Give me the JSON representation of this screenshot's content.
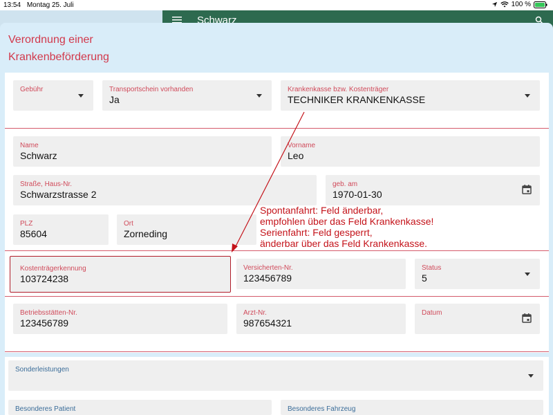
{
  "status_bar": {
    "time": "13:54",
    "date": "Montag 25. Juli",
    "battery": "100 %"
  },
  "background_app": {
    "title": "Schwarz"
  },
  "modal": {
    "title": "Verordnung einer\nKrankenbeförderung"
  },
  "fields": {
    "gebuehr": {
      "label": "Gebühr",
      "value": ""
    },
    "transportschein": {
      "label": "Transportschein vorhanden",
      "value": "Ja"
    },
    "krankenkasse": {
      "label": "Krankenkasse bzw. Kostenträger",
      "value": "TECHNIKER KRANKENKASSE"
    },
    "name": {
      "label": "Name",
      "value": "Schwarz"
    },
    "vorname": {
      "label": "Vorname",
      "value": "Leo"
    },
    "strasse": {
      "label": "Straße, Haus-Nr.",
      "value": "Schwarzstrasse 2"
    },
    "geb_am": {
      "label": "geb. am",
      "value": "1970-01-30"
    },
    "plz": {
      "label": "PLZ",
      "value": "85604"
    },
    "ort": {
      "label": "Ort",
      "value": "Zorneding"
    },
    "kostentraegerkennung": {
      "label": "Kostenträgerkennung",
      "value": "103724238"
    },
    "versicherten_nr": {
      "label": "Versicherten-Nr.",
      "value": "123456789"
    },
    "status": {
      "label": "Status",
      "value": "5"
    },
    "betriebsstaetten_nr": {
      "label": "Betriebsstätten-Nr.",
      "value": "123456789"
    },
    "arzt_nr": {
      "label": "Arzt-Nr.",
      "value": "987654321"
    },
    "datum": {
      "label": "Datum",
      "value": ""
    },
    "sonderleistungen": {
      "label": "Sonderleistungen",
      "value": ""
    },
    "besonderes_patient": {
      "label": "Besonderes Patient",
      "value": ""
    },
    "besonderes_fahrzeug": {
      "label": "Besonderes Fahrzeug",
      "value": ""
    }
  },
  "annotation": {
    "text": "Spontanfahrt: Feld änderbar,\nempfohlen über das Feld Krankenkasse!\nSerienfahrt: Feld gesperrt,\nänderbar über das Feld Krankenkasse."
  },
  "colors": {
    "accent": "#d2384b",
    "annotation": "#c4131a",
    "modal_bg": "#d9edf9",
    "field_bg": "#efefef",
    "app_bar": "#2d6a4f"
  },
  "icons": [
    "location-arrow-icon",
    "wifi-icon",
    "battery-icon",
    "calendar-icon",
    "dropdown-caret-icon",
    "menu-icon",
    "search-icon"
  ]
}
